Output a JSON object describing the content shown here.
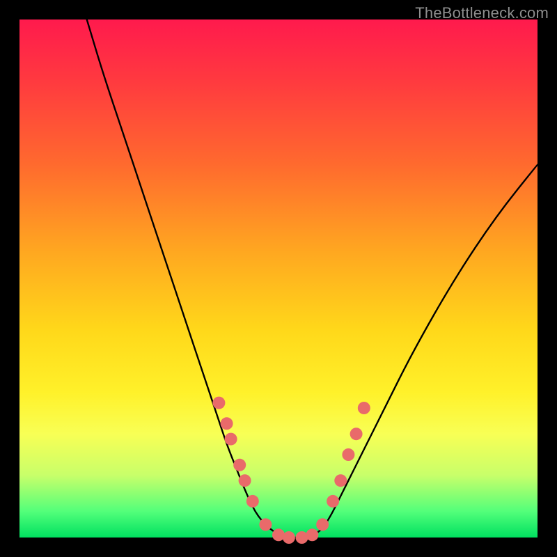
{
  "watermark": "TheBottleneck.com",
  "chart_data": {
    "type": "line",
    "title": "",
    "xlabel": "",
    "ylabel": "",
    "xlim": [
      0,
      100
    ],
    "ylim": [
      0,
      100
    ],
    "series": [
      {
        "name": "bottleneck-curve",
        "x": [
          13,
          16,
          20,
          24,
          28,
          32,
          35,
          38,
          40,
          42,
          44,
          46,
          49,
          52,
          55,
          58,
          60,
          62,
          65,
          70,
          76,
          84,
          92,
          100
        ],
        "y": [
          100,
          90,
          78,
          66,
          54,
          42,
          33,
          24,
          18,
          13,
          8,
          4,
          1,
          0,
          0,
          1,
          4,
          8,
          14,
          24,
          36,
          50,
          62,
          72
        ]
      }
    ],
    "markers": {
      "name": "highlight-points",
      "color": "#e96a6a",
      "points": [
        {
          "x": 38.5,
          "y": 26
        },
        {
          "x": 40.0,
          "y": 22
        },
        {
          "x": 40.8,
          "y": 19
        },
        {
          "x": 42.5,
          "y": 14
        },
        {
          "x": 43.5,
          "y": 11
        },
        {
          "x": 45.0,
          "y": 7
        },
        {
          "x": 47.5,
          "y": 2.5
        },
        {
          "x": 50.0,
          "y": 0.5
        },
        {
          "x": 52.0,
          "y": 0
        },
        {
          "x": 54.5,
          "y": 0
        },
        {
          "x": 56.5,
          "y": 0.5
        },
        {
          "x": 58.5,
          "y": 2.5
        },
        {
          "x": 60.5,
          "y": 7
        },
        {
          "x": 62.0,
          "y": 11
        },
        {
          "x": 63.5,
          "y": 16
        },
        {
          "x": 65.0,
          "y": 20
        },
        {
          "x": 66.5,
          "y": 25
        }
      ]
    },
    "gradient_stops": [
      {
        "pos": 0,
        "color": "#ff1a4d"
      },
      {
        "pos": 12,
        "color": "#ff3a3f"
      },
      {
        "pos": 28,
        "color": "#ff6a2e"
      },
      {
        "pos": 45,
        "color": "#ffa820"
      },
      {
        "pos": 60,
        "color": "#ffd81a"
      },
      {
        "pos": 72,
        "color": "#fff12a"
      },
      {
        "pos": 80,
        "color": "#f8ff55"
      },
      {
        "pos": 88,
        "color": "#c8ff6a"
      },
      {
        "pos": 95,
        "color": "#52ff7a"
      },
      {
        "pos": 100,
        "color": "#00e060"
      }
    ]
  }
}
